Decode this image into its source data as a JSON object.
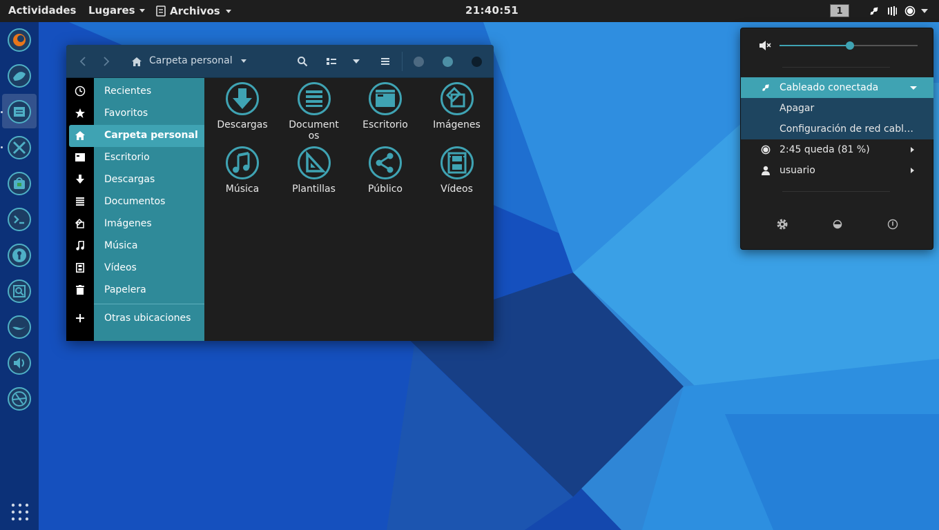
{
  "topbar": {
    "activities": "Actividades",
    "places": "Lugares",
    "files": "Archivos",
    "clock": "21:40:51",
    "workspace": "1",
    "tray_icons": [
      "network-wired-icon",
      "volume-icon",
      "battery-icon",
      "chevron-down-icon"
    ]
  },
  "dock": {
    "apps": [
      "firefox-icon",
      "thunderbird-icon",
      "files-icon",
      "tools-icon",
      "software-icon",
      "terminal-icon",
      "passwords-icon",
      "screenshot-icon",
      "genie-icon",
      "sound-icon",
      "camera-icon"
    ],
    "apps_grid": "show-apps-icon"
  },
  "file_manager": {
    "path_title": "Carpeta personal",
    "sidebar": [
      {
        "label": "Recientes",
        "icon": "clock-icon"
      },
      {
        "label": "Favoritos",
        "icon": "star-icon"
      },
      {
        "label": "Carpeta personal",
        "icon": "home-icon",
        "active": true
      },
      {
        "label": "Escritorio",
        "icon": "desktop-icon"
      },
      {
        "label": "Descargas",
        "icon": "download-icon"
      },
      {
        "label": "Documentos",
        "icon": "documents-icon"
      },
      {
        "label": "Imágenes",
        "icon": "pictures-icon"
      },
      {
        "label": "Música",
        "icon": "music-icon"
      },
      {
        "label": "Vídeos",
        "icon": "video-icon"
      },
      {
        "label": "Papelera",
        "icon": "trash-icon"
      },
      {
        "label": "Otras ubicaciones",
        "icon": "plus-icon"
      }
    ],
    "folders": [
      {
        "label": "Descargas",
        "icon": "download-folder-icon"
      },
      {
        "label": "Documentos",
        "icon": "documents-folder-icon"
      },
      {
        "label": "Escritorio",
        "icon": "desktop-folder-icon"
      },
      {
        "label": "Imágenes",
        "icon": "pictures-folder-icon"
      },
      {
        "label": "Música",
        "icon": "music-folder-icon"
      },
      {
        "label": "Plantillas",
        "icon": "templates-folder-icon"
      },
      {
        "label": "Público",
        "icon": "public-folder-icon"
      },
      {
        "label": "Vídeos",
        "icon": "videos-folder-icon"
      }
    ]
  },
  "system_menu": {
    "volume_level": 0.51,
    "network": {
      "label": "Cableado conectada",
      "submenu": [
        "Apagar",
        "Configuración de red cableada"
      ]
    },
    "battery": "2:45 queda (81 %)",
    "user": "usuario",
    "bottom_buttons": [
      "settings-icon",
      "lock-orientation-icon",
      "power-icon"
    ]
  },
  "colors": {
    "accent": "#3fa3b3",
    "sidebar": "#2f8a99",
    "header": "#1c3f5c",
    "topbar": "#1e1e1e"
  }
}
